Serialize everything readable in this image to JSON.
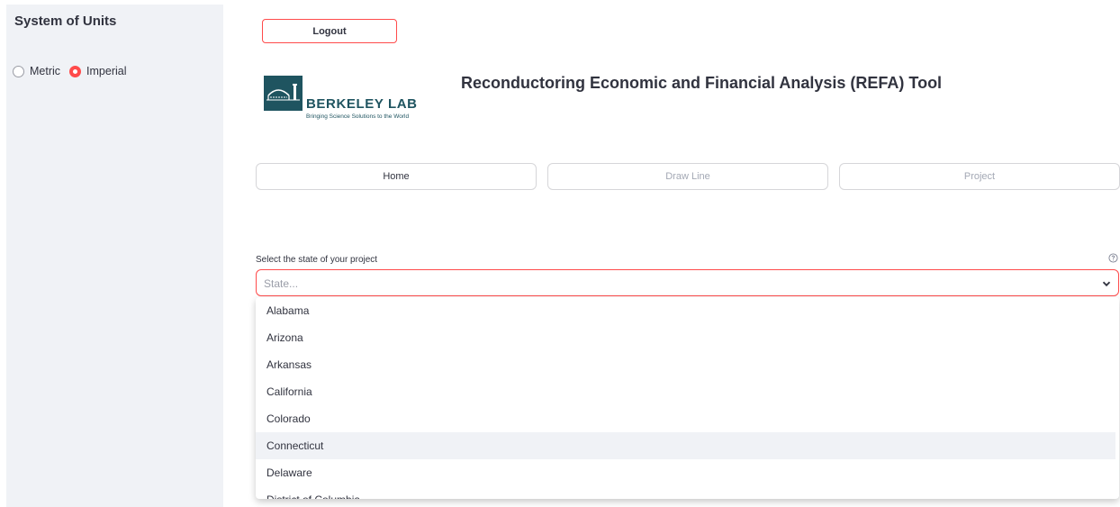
{
  "sidebar": {
    "title": "System of Units",
    "units": {
      "options": [
        "Metric",
        "Imperial"
      ],
      "selected": "Imperial"
    }
  },
  "header": {
    "logout_label": "Logout",
    "logo": {
      "name": "BERKELEY LAB",
      "tagline": "Bringing Science Solutions to the World"
    },
    "title": "Reconductoring Economic and Financial Analysis (REFA) Tool"
  },
  "nav": {
    "home": "Home",
    "draw_line": "Draw Line",
    "project": "Project"
  },
  "state_select": {
    "label": "Select the state of your project",
    "placeholder": "State...",
    "options": [
      "Alabama",
      "Arizona",
      "Arkansas",
      "California",
      "Colorado",
      "Connecticut",
      "Delaware",
      "District of Columbia"
    ],
    "highlighted": "Connecticut"
  },
  "colors": {
    "accent": "#ff4b4b",
    "sidebar_bg": "#f0f2f6",
    "brand": "#1f5460",
    "text": "#31333f",
    "muted": "#a3a8b4"
  }
}
